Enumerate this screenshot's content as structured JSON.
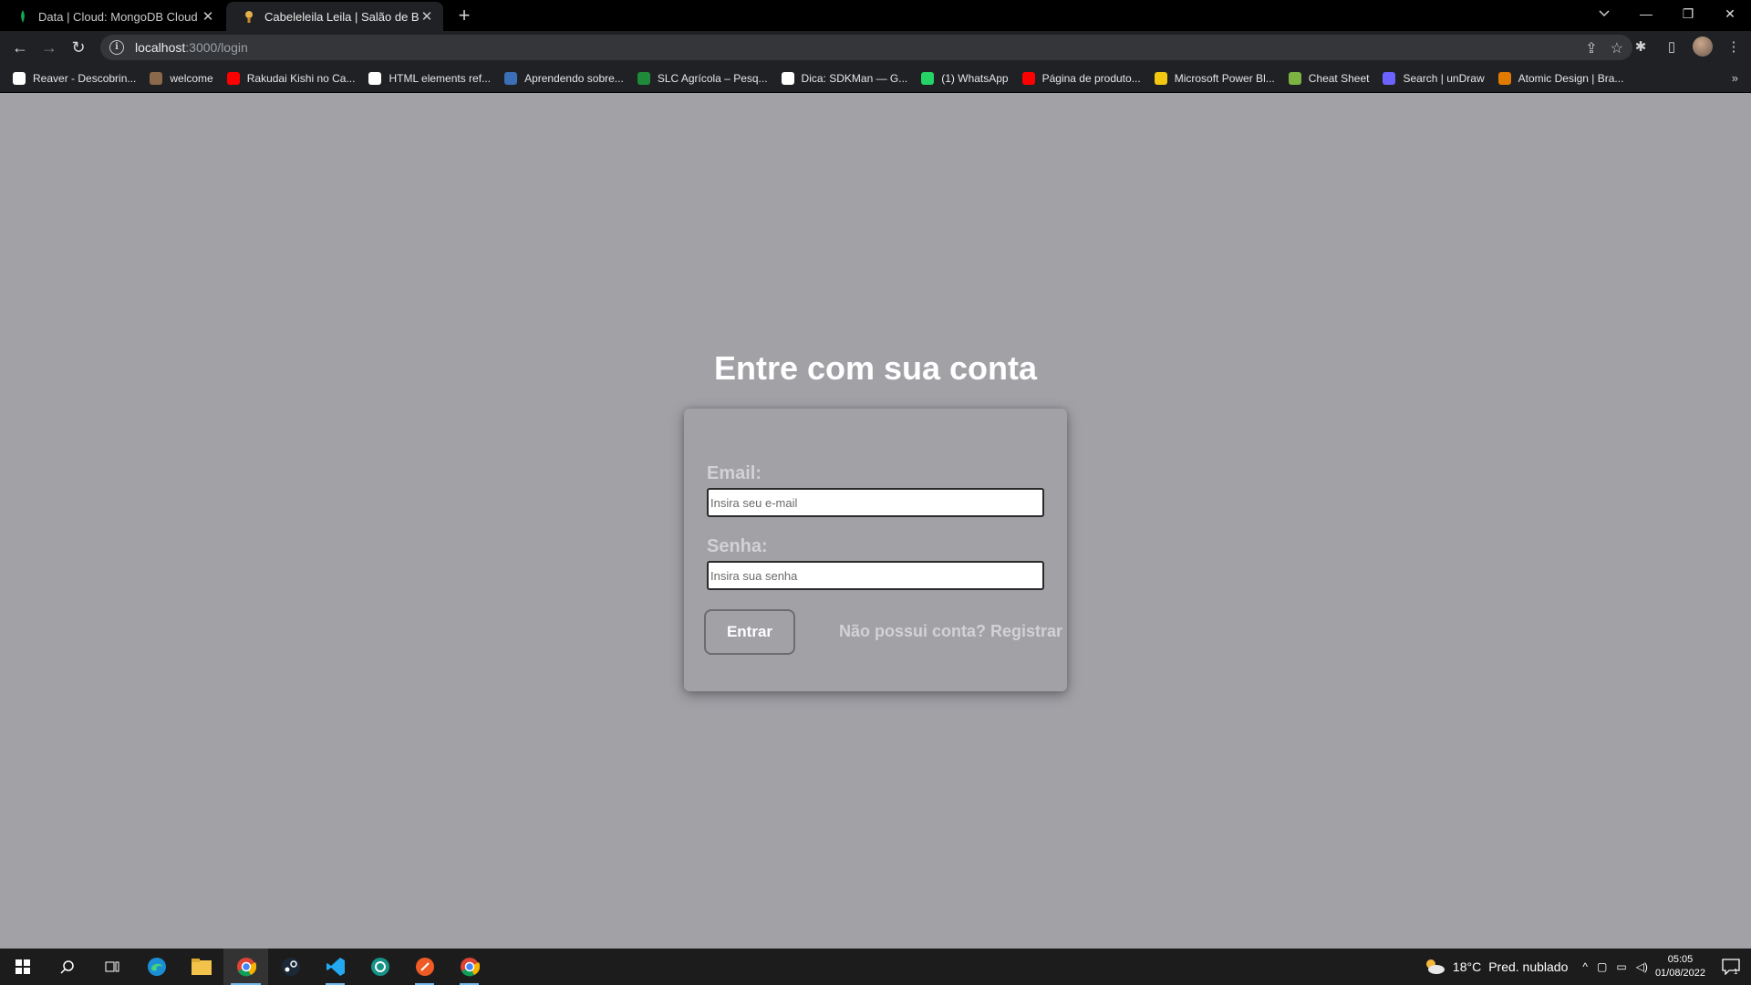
{
  "browser": {
    "tabs": [
      {
        "title": "Data | Cloud: MongoDB Cloud",
        "active": false,
        "favicon": "mongodb-leaf-icon",
        "color": "#13aa52"
      },
      {
        "title": "Cabeleleila Leila | Salão de Beleza",
        "active": true,
        "favicon": "salon-icon",
        "color": "#e3b04b"
      }
    ],
    "url_host": "localhost",
    "url_path": ":3000/login",
    "bookmarks": [
      {
        "label": "Reaver - Descobrin...",
        "color": "#ffffff"
      },
      {
        "label": "welcome",
        "color": "#8a6a4a"
      },
      {
        "label": "Rakudai Kishi no Ca...",
        "color": "#ff0000"
      },
      {
        "label": "HTML elements ref...",
        "color": "#ffffff"
      },
      {
        "label": "Aprendendo sobre...",
        "color": "#3b6fb6"
      },
      {
        "label": "SLC Agrícola – Pesq...",
        "color": "#1f8a3a"
      },
      {
        "label": "Dica: SDKMan — G...",
        "color": "#ffffff"
      },
      {
        "label": "(1) WhatsApp",
        "color": "#25d366"
      },
      {
        "label": "Página de produto...",
        "color": "#ff0000"
      },
      {
        "label": "Microsoft Power Bl...",
        "color": "#f2c811"
      },
      {
        "label": "Cheat Sheet",
        "color": "#7cb342"
      },
      {
        "label": "Search | unDraw",
        "color": "#6c63ff"
      },
      {
        "label": "Atomic Design | Bra...",
        "color": "#e07b00"
      }
    ]
  },
  "login": {
    "title": "Entre com sua conta",
    "email_label": "Email:",
    "email_placeholder": "Insira seu e-mail",
    "email_value": "",
    "password_label": "Senha:",
    "password_placeholder": "Insira sua senha",
    "password_value": "",
    "submit_label": "Entrar",
    "register_link": "Não possui conta? Registrar"
  },
  "taskbar": {
    "weather_temp": "18°C",
    "weather_text": "Pred. nublado",
    "time": "05:05",
    "date": "01/08/2022",
    "notification_count": "1"
  },
  "colors": {
    "page_background": "#a2a1a6",
    "title_text": "#ffffff",
    "label_text": "#d2d2d4"
  }
}
